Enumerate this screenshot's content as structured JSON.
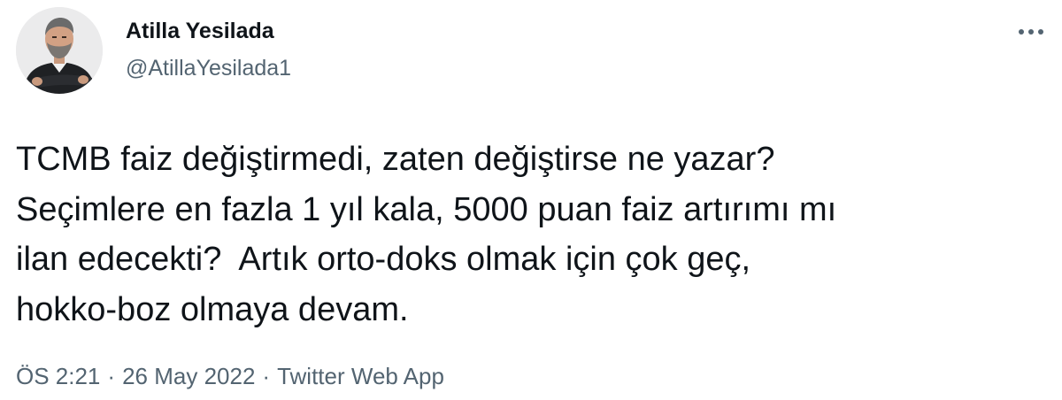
{
  "author": {
    "name": "Atilla Yesilada",
    "handle": "@AtillaYesilada1",
    "avatar_icon": "profile-photo"
  },
  "more_icon": "more-horizontal-icon",
  "tweet": {
    "text": "TCMB faiz değiştirmedi, zaten değiştirse ne yazar?\nSeçimlere en fazla 1 yıl kala, 5000 puan faiz artırımı mı\nilan edecekti?  Artık orto-doks olmak için çok geç,\nhokko-boz olmaya devam."
  },
  "meta": {
    "time": "ÖS 2:21",
    "separator": "·",
    "date": "26 May 2022",
    "source": "Twitter Web App"
  },
  "colors": {
    "text": "#0f1419",
    "secondary": "#536471",
    "background": "#ffffff"
  }
}
